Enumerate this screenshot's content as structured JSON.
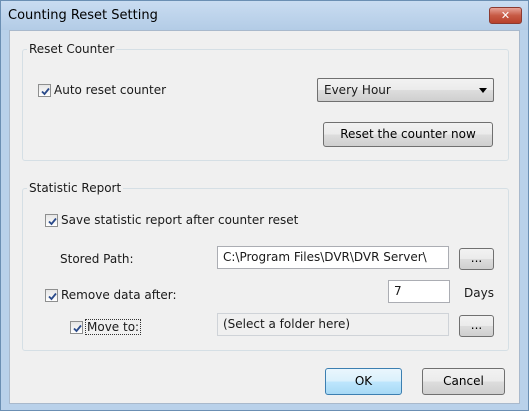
{
  "window": {
    "title": "Counting Reset Setting",
    "close_glyph": "✕"
  },
  "reset_counter": {
    "group_title": "Reset Counter",
    "auto_reset_label": "Auto reset counter",
    "auto_reset_checked": true,
    "interval_selected": "Every Hour",
    "reset_now_label": "Reset the counter now"
  },
  "statistic_report": {
    "group_title": "Statistic Report",
    "save_report_label": "Save statistic report after counter reset",
    "save_report_checked": true,
    "stored_path_label": "Stored Path:",
    "stored_path_value": "C:\\Program Files\\DVR\\DVR Server\\",
    "browse_label": "...",
    "remove_data_label": "Remove data after:",
    "remove_data_checked": true,
    "remove_days_value": "7",
    "days_unit": "Days",
    "move_to_label": "Move to:",
    "move_to_checked": true,
    "move_to_placeholder": "(Select a folder here)",
    "move_browse_label": "..."
  },
  "footer": {
    "ok_label": "OK",
    "cancel_label": "Cancel"
  },
  "icons": {
    "check": "checkmark-icon",
    "dropdown": "chevron-down-icon",
    "close": "close-icon"
  }
}
